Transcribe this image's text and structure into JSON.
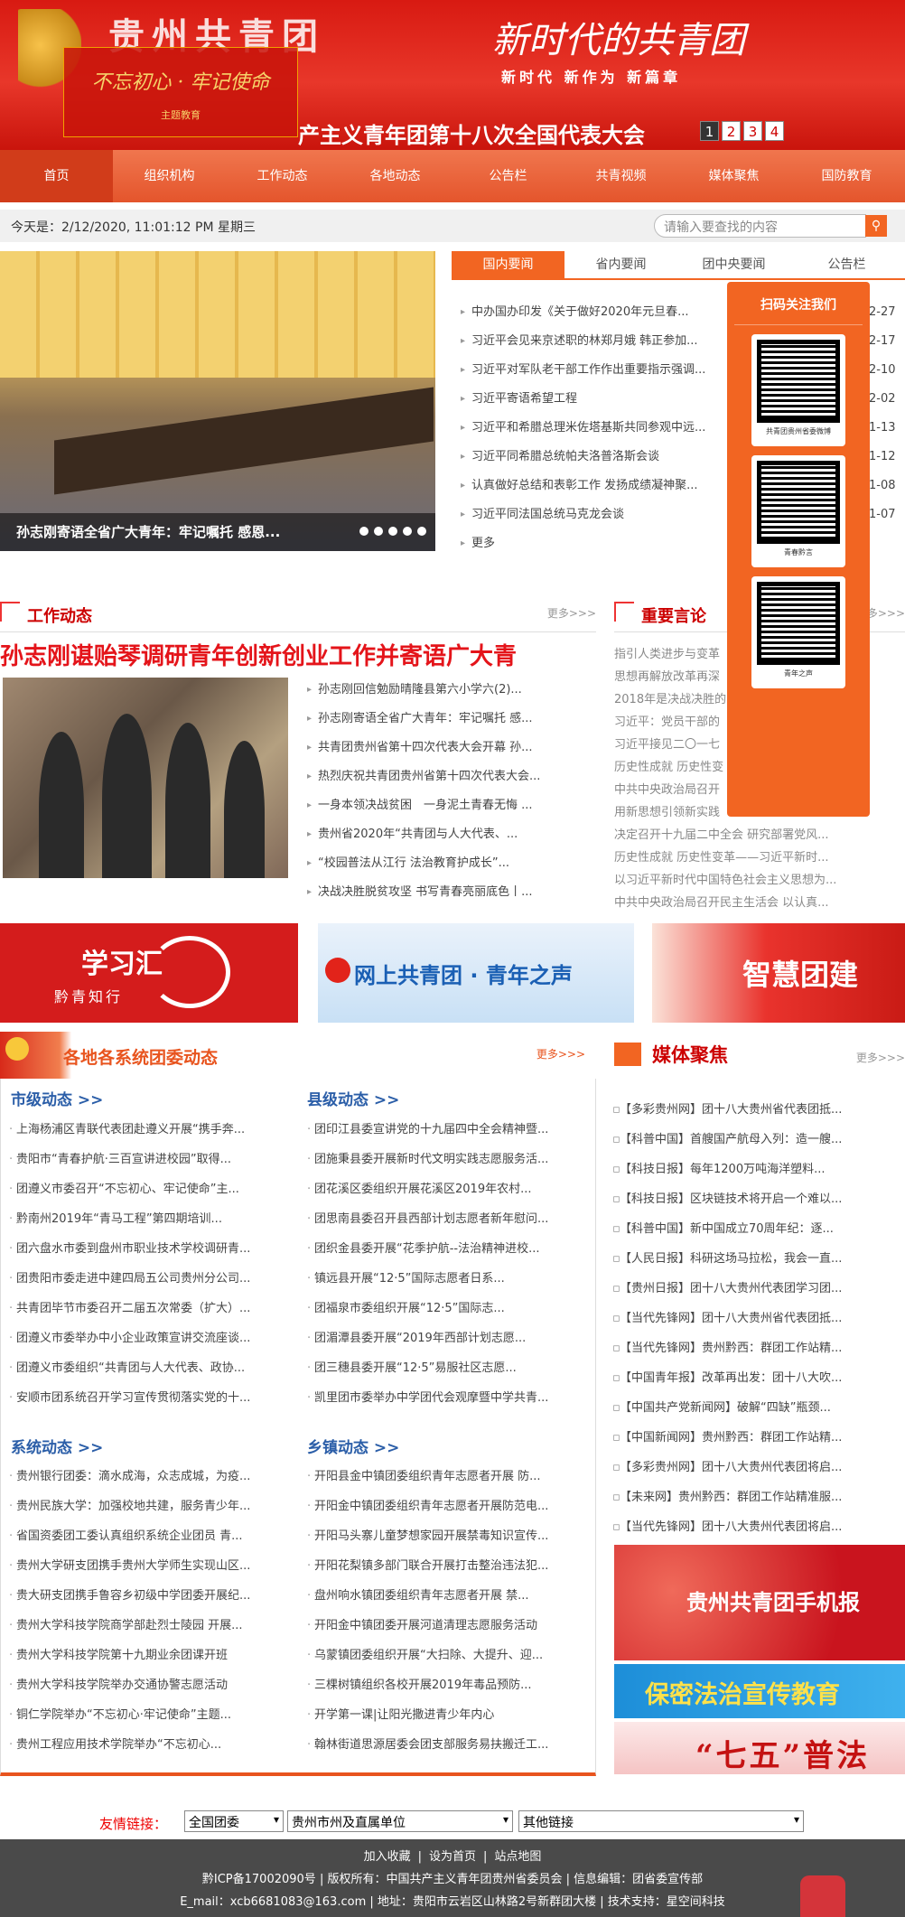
{
  "header": {
    "site_title": "贵州共青团",
    "motto": "不忘初心 · 牢记使命",
    "motto_sub": "主题教育",
    "congress": "产主义青年团第十八次全国代表大会",
    "new_era_title": "新时代的共青团",
    "slogans": "新时代  新作为  新篇章",
    "pages": [
      "1",
      "2",
      "3",
      "4"
    ]
  },
  "nav": [
    "首页",
    "组织机构",
    "工作动态",
    "各地动态",
    "公告栏",
    "共青视频",
    "媒体聚焦",
    "国防教育"
  ],
  "date_bar": {
    "date_text": "今天是：2/12/2020, 11:01:12 PM 星期三",
    "search_placeholder": "请输入要查找的内容",
    "search_icon": "search-icon"
  },
  "slider": {
    "caption": "孙志刚寄语全省广大青年：牢记嘱托 感恩...",
    "dots": 5
  },
  "news_tabs": [
    "国内要闻",
    "省内要闻",
    "团中央要闻",
    "公告栏"
  ],
  "news_items": [
    {
      "title": "中办国办印发《关于做好2020年元旦春...",
      "date": "2-27"
    },
    {
      "title": "习近平会见来京述职的林郑月娥 韩正参加...",
      "date": "2-17"
    },
    {
      "title": "习近平对军队老干部工作作出重要指示强调...",
      "date": "2-10"
    },
    {
      "title": "习近平寄语希望工程",
      "date": "2-02"
    },
    {
      "title": "习近平和希腊总理米佐塔基斯共同参观中远...",
      "date": "1-13"
    },
    {
      "title": "习近平同希腊总统帕夫洛普洛斯会谈",
      "date": "1-12"
    },
    {
      "title": "认真做好总结和表彰工作 发扬成绩凝神聚...",
      "date": "1-08"
    },
    {
      "title": "习近平同法国总统马克龙会谈",
      "date": "1-07"
    },
    {
      "title": "更多",
      "date": ""
    }
  ],
  "qr_panel": {
    "head": "扫码关注我们",
    "codes": [
      "共青团贵州省委微博",
      "青春黔言",
      "青年之声"
    ]
  },
  "work": {
    "heading": "工作动态",
    "more": "更多>>>",
    "headline": "孙志刚谌贻琴调研青年创新创业工作并寄语广大青",
    "items": [
      "孙志刚回信勉励晴隆县第六小学六(2)...",
      "孙志刚寄语全省广大青年：牢记嘱托 感...",
      "共青团贵州省第十四次代表大会开幕 孙...",
      "热烈庆祝共青团贵州省第十四次代表大会...",
      "一身本领决战贫困　一身泥土青春无悔 ...",
      "贵州省2020年“共青团与人大代表、...",
      "“校园普法从江行 法治教育护成长”...",
      "决战决胜脱贫攻坚 书写青春亮丽底色丨..."
    ]
  },
  "quotes": {
    "heading": "重要言论",
    "more": "更多>>>",
    "items": [
      "指引人类进步与变革",
      "思想再解放改革再深",
      "2018年是决战决胜的",
      "习近平：党员干部的",
      "习近平接见二〇一七",
      "历史性成就 历史性变",
      "中共中央政治局召开",
      "用新思想引领新实践",
      "决定召开十九届二中全会 研究部署党风...",
      "历史性成就 历史性变革——习近平新时...",
      "以习近平新时代中国特色社会主义思想为...",
      "中共中央政治局召开民主生活会 以认真..."
    ]
  },
  "banners": {
    "xuexi_title": "学习汇",
    "xuexi_sub": "黔青知行",
    "online_league": "网上共青团 · 青年之声",
    "smart": "智慧团建"
  },
  "regional": {
    "heading": "各地各系统团委动态",
    "more": "更多>>>",
    "city": {
      "title": "市级动态 >>",
      "items": [
        "上海杨浦区青联代表团赴遵义开展“携手奔...",
        "贵阳市“青春护航·三百宣讲进校园”取得...",
        "团遵义市委召开“不忘初心、牢记使命”主...",
        "黔南州2019年“青马工程”第四期培训...",
        "团六盘水市委到盘州市职业技术学校调研青...",
        "团贵阳市委走进中建四局五公司贵州分公司...",
        "共青团毕节市委召开二届五次常委（扩大）...",
        "团遵义市委举办中小企业政策宣讲交流座谈...",
        "团遵义市委组织“共青团与人大代表、政协...",
        "安顺市团系统召开学习宣传贯彻落实党的十..."
      ]
    },
    "county": {
      "title": "县级动态 >>",
      "items": [
        "团印江县委宣讲党的十九届四中全会精神暨...",
        "团施秉县委开展新时代文明实践志愿服务活...",
        "团花溪区委组织开展花溪区2019年农村...",
        "团思南县委召开县西部计划志愿者新年慰问...",
        "团织金县委开展“花季护航--法治精神进校...",
        "镇远县开展“12·5”国际志愿者日系...",
        "团福泉市委组织开展“12·5”国际志...",
        "团湄潭县委开展“2019年西部计划志愿...",
        "团三穗县委开展“12·5”易服社区志愿...",
        "凯里团市委举办中学团代会观摩暨中学共青..."
      ]
    },
    "system": {
      "title": "系统动态 >>",
      "items": [
        "贵州银行团委：滴水成海，众志成城，为疫...",
        "贵州民族大学：加强校地共建，服务青少年...",
        "省国资委团工委认真组织系统企业团员 青...",
        "贵州大学研支团携手贵州大学师生实现山区...",
        "贵大研支团携手鲁容乡初级中学团委开展纪...",
        "贵州大学科技学院商学部赴烈士陵园 开展...",
        "贵州大学科技学院第十九期业余团课开班",
        "贵州大学科技学院举办交通协警志愿活动",
        "铜仁学院举办“不忘初心·牢记使命”主题...",
        "贵州工程应用技术学院举办“不忘初心..."
      ]
    },
    "township": {
      "title": "乡镇动态 >>",
      "items": [
        "开阳县金中镇团委组织青年志愿者开展 防...",
        "开阳金中镇团委组织青年志愿者开展防范电...",
        "开阳马头寨儿童梦想家园开展禁毒知识宣传...",
        "开阳花梨镇多部门联合开展打击整治违法犯...",
        "盘州响水镇团委组织青年志愿者开展 禁...",
        "开阳金中镇团委开展河道清理志愿服务活动",
        "乌蒙镇团委组织开展“大扫除、大提升、迎...",
        "三棵树镇组织各校开展2019年毒品预防...",
        "开学第一课|让阳光撒进青少年内心",
        "翰林街道思源居委会团支部服务易扶搬迁工..."
      ]
    }
  },
  "media": {
    "heading": "媒体聚焦",
    "more": "更多>>>",
    "items": [
      "【多彩贵州网】团十八大贵州省代表团抵...",
      "【科普中国】首艘国产航母入列：造一艘...",
      "【科技日报】每年1200万吨海洋塑料...",
      "【科技日报】区块链技术将开启一个难以...",
      "【科普中国】新中国成立70周年纪：逐...",
      "【人民日报】科研这场马拉松，我会一直...",
      "【贵州日报】团十八大贵州代表团学习团...",
      "【当代先锋网】团十八大贵州省代表团抵...",
      "【当代先锋网】贵州黔西：群团工作站精...",
      "【中国青年报】改革再出发：团十八大吹...",
      "【中国共产党新闻网】破解“四缺”瓶颈...",
      "【中国新闻网】贵州黔西：群团工作站精...",
      "【多彩贵州网】团十八大贵州代表团将启...",
      "【未来网】贵州黔西：群团工作站精准服...",
      "【当代先锋网】团十八大贵州代表团将启..."
    ],
    "banner_mobile": "贵州共青团手机报",
    "banner_secrecy": "保密法治宣传教育",
    "banner_law": "“七五”普法"
  },
  "links": {
    "label": "友情链接：",
    "selects": [
      "全国团委",
      "贵州市州及直属单位",
      "其他链接"
    ]
  },
  "footer": {
    "links": [
      "加入收藏",
      "设为首页",
      "站点地图"
    ],
    "line2": "黔ICP备17002090号 | 版权所有：中国共产主义青年团贵州省委员会 | 信息编辑：团省委宣传部",
    "line3": "E_mail：xcb6681083@163.com | 地址：贵阳市云岩区山林路2号新群团大楼 | 技术支持：星空间科技"
  }
}
